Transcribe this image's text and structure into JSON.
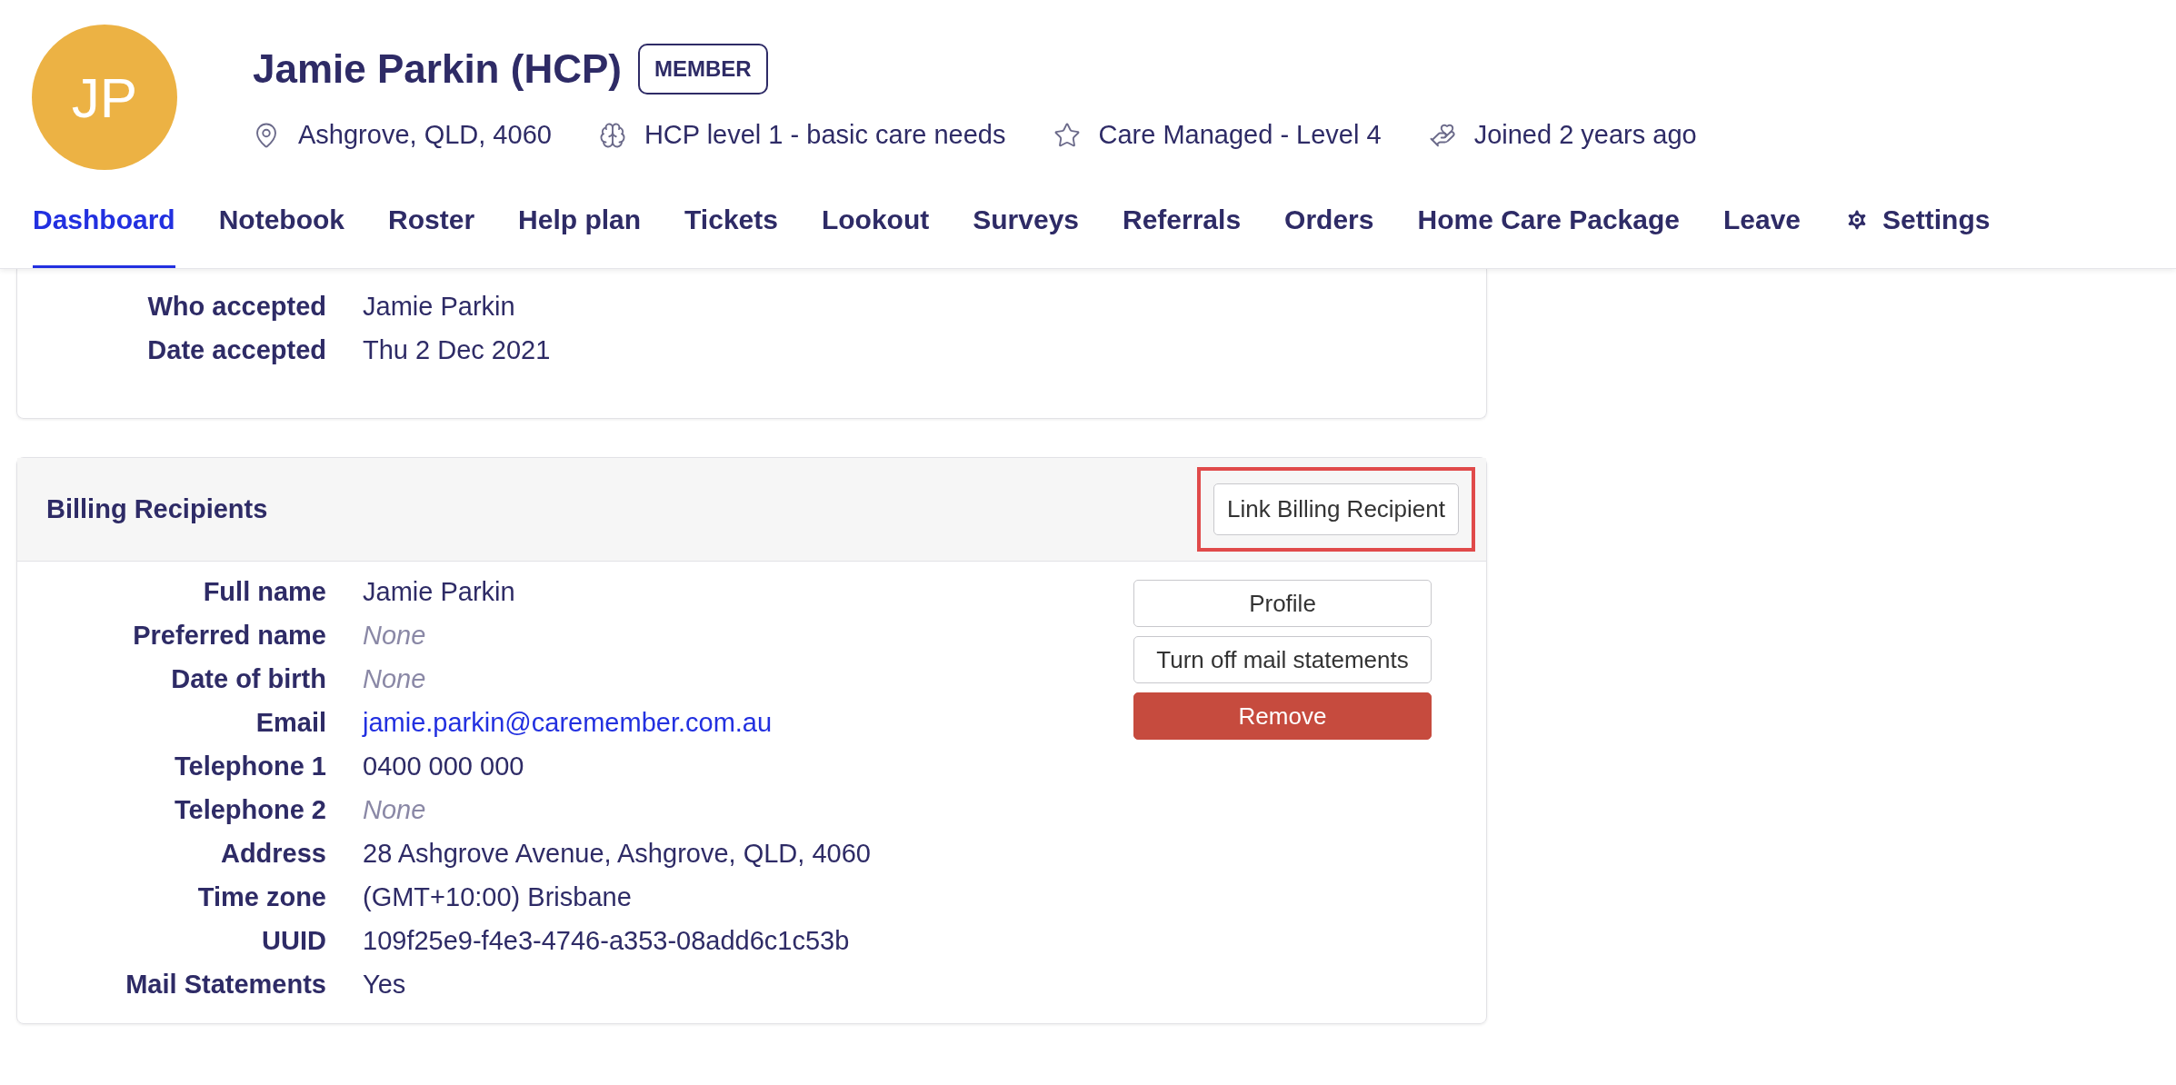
{
  "profile": {
    "initials": "JP",
    "name": "Jamie Parkin (HCP)",
    "badge": "MEMBER",
    "meta": [
      {
        "kind": "location",
        "text": "Ashgrove, QLD, 4060"
      },
      {
        "kind": "brain",
        "text": "HCP level 1 - basic care needs"
      },
      {
        "kind": "star",
        "text": "Care Managed - Level 4"
      },
      {
        "kind": "hand",
        "text": "Joined 2 years ago"
      }
    ]
  },
  "tabs": [
    {
      "label": "Dashboard",
      "selected": true,
      "kind": "text"
    },
    {
      "label": "Notebook",
      "selected": false,
      "kind": "text"
    },
    {
      "label": "Roster",
      "selected": false,
      "kind": "text"
    },
    {
      "label": "Help plan",
      "selected": false,
      "kind": "text"
    },
    {
      "label": "Tickets",
      "selected": false,
      "kind": "text"
    },
    {
      "label": "Lookout",
      "selected": false,
      "kind": "text"
    },
    {
      "label": "Surveys",
      "selected": false,
      "kind": "text"
    },
    {
      "label": "Referrals",
      "selected": false,
      "kind": "text"
    },
    {
      "label": "Orders",
      "selected": false,
      "kind": "text"
    },
    {
      "label": "Home Care Package",
      "selected": false,
      "kind": "text"
    },
    {
      "label": "Leave",
      "selected": false,
      "kind": "text"
    },
    {
      "label": "Settings",
      "selected": false,
      "kind": "gear"
    }
  ],
  "acceptance_card": {
    "fields": [
      {
        "label": "Who accepted",
        "value": "Jamie Parkin",
        "kind": "text"
      },
      {
        "label": "Date accepted",
        "value": "Thu 2 Dec 2021",
        "kind": "text"
      }
    ]
  },
  "billing_card": {
    "title": "Billing Recipients",
    "link_button": {
      "label": "Link Billing Recipient",
      "highlighted": true
    },
    "fields": [
      {
        "label": "Full name",
        "value": "Jamie Parkin",
        "kind": "text"
      },
      {
        "label": "Preferred name",
        "value": "None",
        "kind": "none"
      },
      {
        "label": "Date of birth",
        "value": "None",
        "kind": "none"
      },
      {
        "label": "Email",
        "value": "jamie.parkin@caremember.com.au",
        "kind": "link"
      },
      {
        "label": "Telephone 1",
        "value": "0400 000 000",
        "kind": "text"
      },
      {
        "label": "Telephone 2",
        "value": "None",
        "kind": "none"
      },
      {
        "label": "Address",
        "value": "28 Ashgrove Avenue, Ashgrove, QLD, 4060",
        "kind": "text"
      },
      {
        "label": "Time zone",
        "value": "(GMT+10:00) Brisbane",
        "kind": "text"
      },
      {
        "label": "UUID",
        "value": "109f25e9-f4e3-4746-a353-08add6c1c53b",
        "kind": "text"
      },
      {
        "label": "Mail Statements",
        "value": "Yes",
        "kind": "text"
      }
    ],
    "actions": [
      {
        "label": "Profile",
        "kind": "outline"
      },
      {
        "label": "Turn off mail statements",
        "kind": "outline"
      },
      {
        "label": "Remove",
        "kind": "danger"
      }
    ]
  }
}
